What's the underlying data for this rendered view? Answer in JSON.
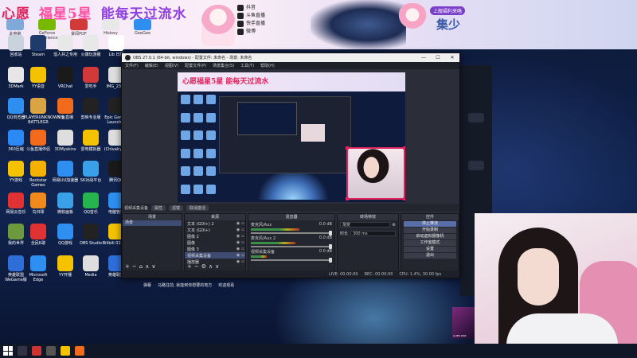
{
  "banner": {
    "slogan": [
      "心愿",
      "福星5星",
      "能每天过流水"
    ],
    "apps": [
      "此电脑",
      "GeForce Experience",
      "掌阅PDF",
      "History",
      "GeeGee"
    ],
    "info_lines": [
      "抖音",
      "斗鱼直播",
      "快手直播",
      "微博"
    ],
    "badge": "上舰福利来咯",
    "cheer": "集少"
  },
  "desktop_icons": [
    {
      "label": "回收站",
      "color": "#c9d3de"
    },
    {
      "label": "Steam",
      "color": "#1f3b6b"
    },
    {
      "label": "溜人并之专用",
      "color": "#e8e8e8"
    },
    {
      "label": "火爆玩游服",
      "color": "#e8e8e8"
    },
    {
      "label": "Lib 日历",
      "color": "#ffffff"
    },
    {
      "label": "3DMark",
      "color": "#e6e6e6"
    },
    {
      "label": "YY语音",
      "color": "#f5c200"
    },
    {
      "label": "VRChat",
      "color": "#1a1a1a"
    },
    {
      "label": "爱吃手",
      "color": "#d23a3a"
    },
    {
      "label": "IMG_2363",
      "color": "#dedede"
    },
    {
      "label": "QQ浏览器",
      "color": "#2f8ff0"
    },
    {
      "label": "PLAYERUNKNOWN'S BATTLEGR",
      "color": "#d9a441"
    },
    {
      "label": "斗鱼直播",
      "color": "#f26b1d"
    },
    {
      "label": "剪映专业版",
      "color": "#222"
    },
    {
      "label": "Epic Games Launcher",
      "color": "#222"
    },
    {
      "label": "360压缩",
      "color": "#2b8af5"
    },
    {
      "label": "斗鱼直播伴侣",
      "color": "#f26b1d"
    },
    {
      "label": "3DMyskins",
      "color": "#dedede"
    },
    {
      "label": "雷电模拟器",
      "color": "#f5c200"
    },
    {
      "label": "(ChivalryA...",
      "color": "#dedede"
    },
    {
      "label": "YY游戏",
      "color": "#f5c200"
    },
    {
      "label": "Rockstar Games",
      "color": "#f5b100"
    },
    {
      "label": "网易UU加速器",
      "color": "#2f8ff0"
    },
    {
      "label": "SK对战平台",
      "color": "#3aa0e8"
    },
    {
      "label": "腾讯QQ",
      "color": "#1a1a1a"
    },
    {
      "label": "网易云音乐",
      "color": "#e03232"
    },
    {
      "label": "鸟归球",
      "color": "#f08a1d"
    },
    {
      "label": "微软画板",
      "color": "#3aa0e8"
    },
    {
      "label": "QQ音乐",
      "color": "#26b44e"
    },
    {
      "label": "电脑管家",
      "color": "#2f8ff0"
    },
    {
      "label": "我的世界",
      "color": "#6c9a3c"
    },
    {
      "label": "全民K歌",
      "color": "#e03232"
    },
    {
      "label": "QQ游戏",
      "color": "#2f8ff0"
    },
    {
      "label": "OBS Studio",
      "color": "#222"
    },
    {
      "label": "Bilibili 02 横屏",
      "color": "#f5c200"
    },
    {
      "label": "英雄联盟 WeGame版",
      "color": "#2f6ed8"
    },
    {
      "label": "Microsoft Edge",
      "color": "#2f8ff0"
    },
    {
      "label": "YY开播",
      "color": "#f5c200"
    },
    {
      "label": "Media",
      "color": "#dedede"
    },
    {
      "label": "英雄联盟",
      "color": "#2f6ed8"
    }
  ],
  "obs": {
    "title": "OBS 27.0.1 (64-bit, windows) - 配置文件: 未命名 - 场景: 未命名",
    "menus": [
      "文件(F)",
      "编辑(E)",
      "视图(V)",
      "配置文件(P)",
      "场景集合(S)",
      "工具(T)",
      "帮助(H)"
    ],
    "window_controls": [
      "—",
      "☐",
      "✕"
    ],
    "source_bar": {
      "label": "视频采集设备",
      "buttons": [
        "属性",
        "滤镜",
        "取消激活"
      ]
    },
    "scenes": {
      "header": "场景",
      "items": [
        "场景"
      ]
    },
    "sources": {
      "header": "来源",
      "items": [
        "文本 (GDI+) 2",
        "文本 (GDI+)",
        "图像 2",
        "图像",
        "图像 3",
        "视频采集设备",
        "播放器"
      ]
    },
    "mixer": {
      "header": "混音器",
      "tracks": [
        {
          "name": "麦克风/Aux",
          "db": "0.0 dB",
          "level": 0.6
        },
        {
          "name": "麦克风/Aux 2",
          "db": "0.0 dB",
          "level": 0.55
        },
        {
          "name": "视频采集设备",
          "db": "0.0 dB",
          "level": 0.2
        }
      ]
    },
    "transitions": {
      "header": "转场特效",
      "type": "渐变",
      "duration_label": "时长",
      "duration": "300 ms"
    },
    "controls": {
      "header": "控件",
      "buttons": [
        "停止推流",
        "开始录制",
        "启动虚拟摄像机",
        "工作室模式",
        "设置",
        "退出"
      ]
    },
    "status": {
      "live": "LIVE: 00:00:00",
      "rec": "REC: 00:00:00",
      "cpu": "CPU: 1.4%, 30.00 fps"
    }
  },
  "chat_line": [
    "弹幕",
    "马路往前, 就能到你想要的地方",
    "欢迎观看"
  ],
  "preview_banner": "心愿福星5星 能每天过流水"
}
